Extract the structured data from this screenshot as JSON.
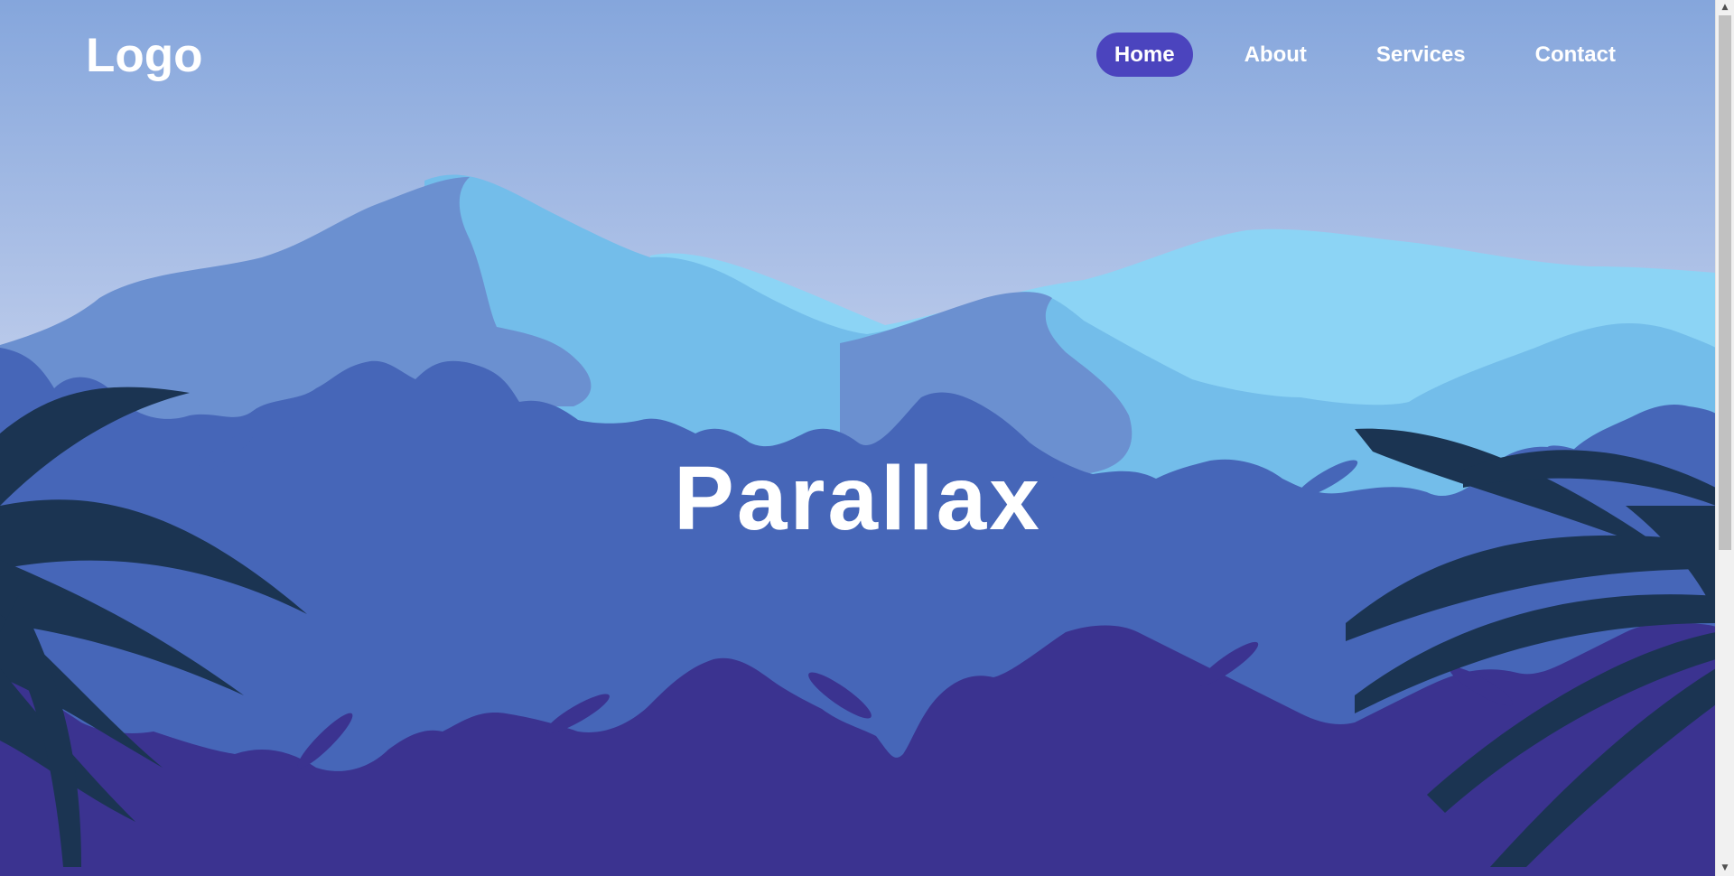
{
  "header": {
    "logo": "Logo",
    "nav": [
      {
        "label": "Home",
        "active": true
      },
      {
        "label": "About",
        "active": false
      },
      {
        "label": "Services",
        "active": false
      },
      {
        "label": "Contact",
        "active": false
      }
    ]
  },
  "hero": {
    "title": "Parallax"
  },
  "scrollbar": {
    "up_icon": "triangle-up-icon",
    "down_icon": "triangle-down-icon",
    "position": 0
  },
  "colors": {
    "sky_top": "#85a6dc",
    "sky_bottom": "#b9c9ea",
    "mountain_far": "#8cd4f5",
    "mountain_mid": "#73bdea",
    "mountain_dark": "#6b90d0",
    "jungle_mid": "#4666b8",
    "jungle_front": "#3b3390",
    "leaves": "#1b3452",
    "nav_active": "#4b44be",
    "text": "#ffffff"
  }
}
